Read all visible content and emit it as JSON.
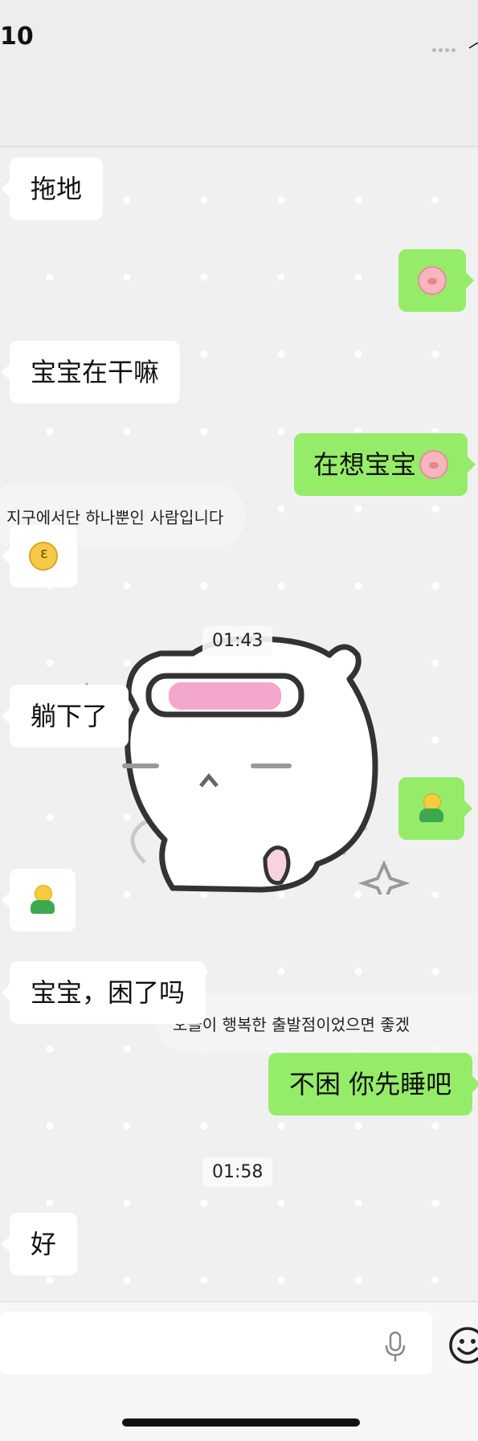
{
  "status_bar": {
    "time": "10",
    "wifi_icon": "wifi-icon",
    "signal_icon": "signal-icon"
  },
  "messages": [
    {
      "side": "in",
      "kind": "text",
      "text": "拖地"
    },
    {
      "side": "out",
      "kind": "emoji",
      "emoji": "pig-icon"
    },
    {
      "side": "in",
      "kind": "text",
      "text": "宝宝在干嘛"
    },
    {
      "side": "out",
      "kind": "text",
      "text": "在想宝宝",
      "trailing_emoji": "pig-icon"
    },
    {
      "side": "in",
      "kind": "emoji",
      "emoji": "kissing-face-icon"
    },
    {
      "side": "in",
      "kind": "text",
      "text": "躺下了"
    },
    {
      "side": "out",
      "kind": "emoji",
      "emoji": "hugging-person-icon"
    },
    {
      "side": "in",
      "kind": "emoji",
      "emoji": "hugging-person-icon"
    },
    {
      "side": "in",
      "kind": "text",
      "text": "宝宝，困了吗"
    },
    {
      "side": "out",
      "kind": "text",
      "text": "不困 你先睡吧"
    },
    {
      "side": "in",
      "kind": "text",
      "text": "好"
    }
  ],
  "timestamps": [
    "01:43",
    "01:58"
  ],
  "background_captions": [
    "지구에서단 하나뿐인 사람입니다",
    "오늘이 행복한 출발점이었으면 좋겠"
  ],
  "sticker": "white-cat-sticker",
  "input": {
    "value": "",
    "mic_icon": "microphone-icon",
    "emoji_icon": "smiley-icon"
  },
  "colors": {
    "incoming_bubble": "#ffffff",
    "outgoing_bubble": "#95ec69",
    "background": "#f0f0f0"
  }
}
